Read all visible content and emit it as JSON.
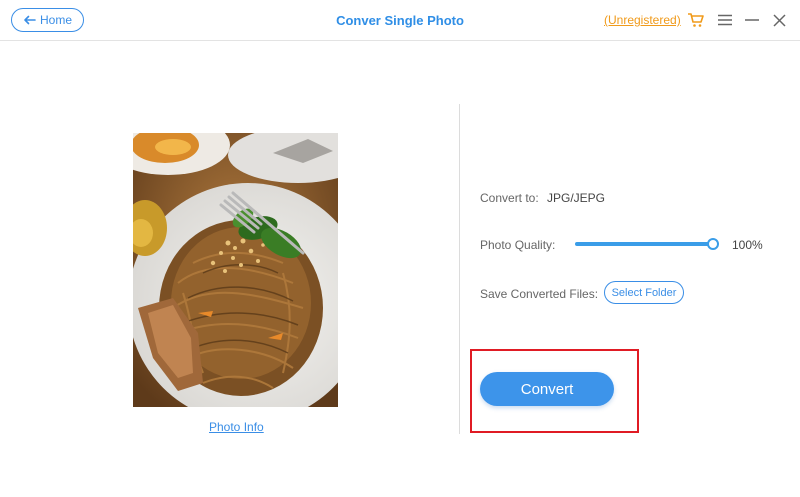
{
  "titlebar": {
    "home_label": "Home",
    "title": "Conver Single Photo",
    "unregistered_label": "(Unregistered)",
    "accent_color": "#2f8ee6",
    "unregistered_color": "#f09a1a",
    "icons": [
      "arrow-left-icon",
      "cart-icon",
      "menu-icon",
      "minimize-icon",
      "close-icon"
    ]
  },
  "preview": {
    "photo_info_label": "Photo Info"
  },
  "settings": {
    "convert_to_label": "Convert to:",
    "convert_to_value": "JPG/JEPG",
    "quality_label": "Photo Quality:",
    "quality_value": "100%",
    "quality_fraction": 1.0,
    "save_label": "Save Converted Files:",
    "select_folder_label": "Select Folder"
  },
  "actions": {
    "convert_label": "Convert",
    "highlight_color": "#e01b24"
  }
}
